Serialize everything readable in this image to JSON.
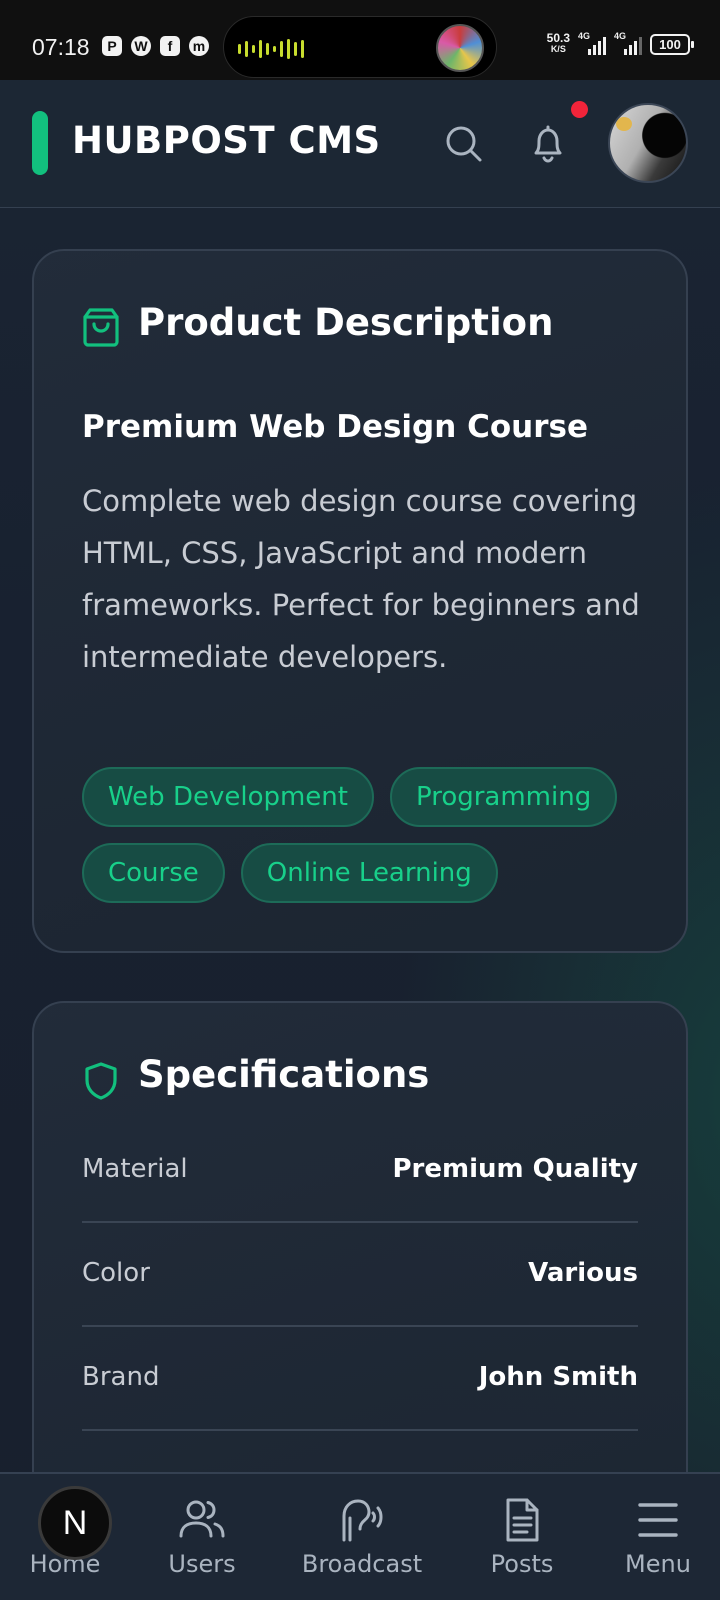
{
  "status_bar": {
    "time": "07:18",
    "app_icons": [
      "P",
      "W",
      "f",
      "m"
    ],
    "net_speed_value": "50.3",
    "net_speed_unit": "K/S",
    "sim1_label": "4G",
    "sim2_label": "4G",
    "battery": "100"
  },
  "header": {
    "brand": "HUBPOST CMS",
    "accent_color": "#12c07e",
    "notification_dot_color": "#f1243a",
    "icons": [
      "search-icon",
      "bell-icon"
    ]
  },
  "product_card": {
    "title": "Product Description",
    "icon": "shopping-bag-icon",
    "name": "Premium Web Design Course",
    "description": "Complete web design course covering HTML, CSS, JavaScript and modern frameworks. Perfect for beginners and intermediate developers.",
    "tags": [
      "Web Development",
      "Programming",
      "Course",
      "Online Learning"
    ]
  },
  "specs_card": {
    "title": "Specifications",
    "icon": "shield-icon",
    "rows": [
      {
        "label": "Material",
        "value": "Premium Quality"
      },
      {
        "label": "Color",
        "value": "Various"
      },
      {
        "label": "Brand",
        "value": "John Smith"
      }
    ]
  },
  "bottom_nav": {
    "fab_letter": "N",
    "items": [
      {
        "label": "Home",
        "icon": "home-icon"
      },
      {
        "label": "Users",
        "icon": "users-icon"
      },
      {
        "label": "Broadcast",
        "icon": "broadcast-icon"
      },
      {
        "label": "Posts",
        "icon": "document-icon"
      },
      {
        "label": "Menu",
        "icon": "hamburger-menu-icon"
      }
    ]
  }
}
